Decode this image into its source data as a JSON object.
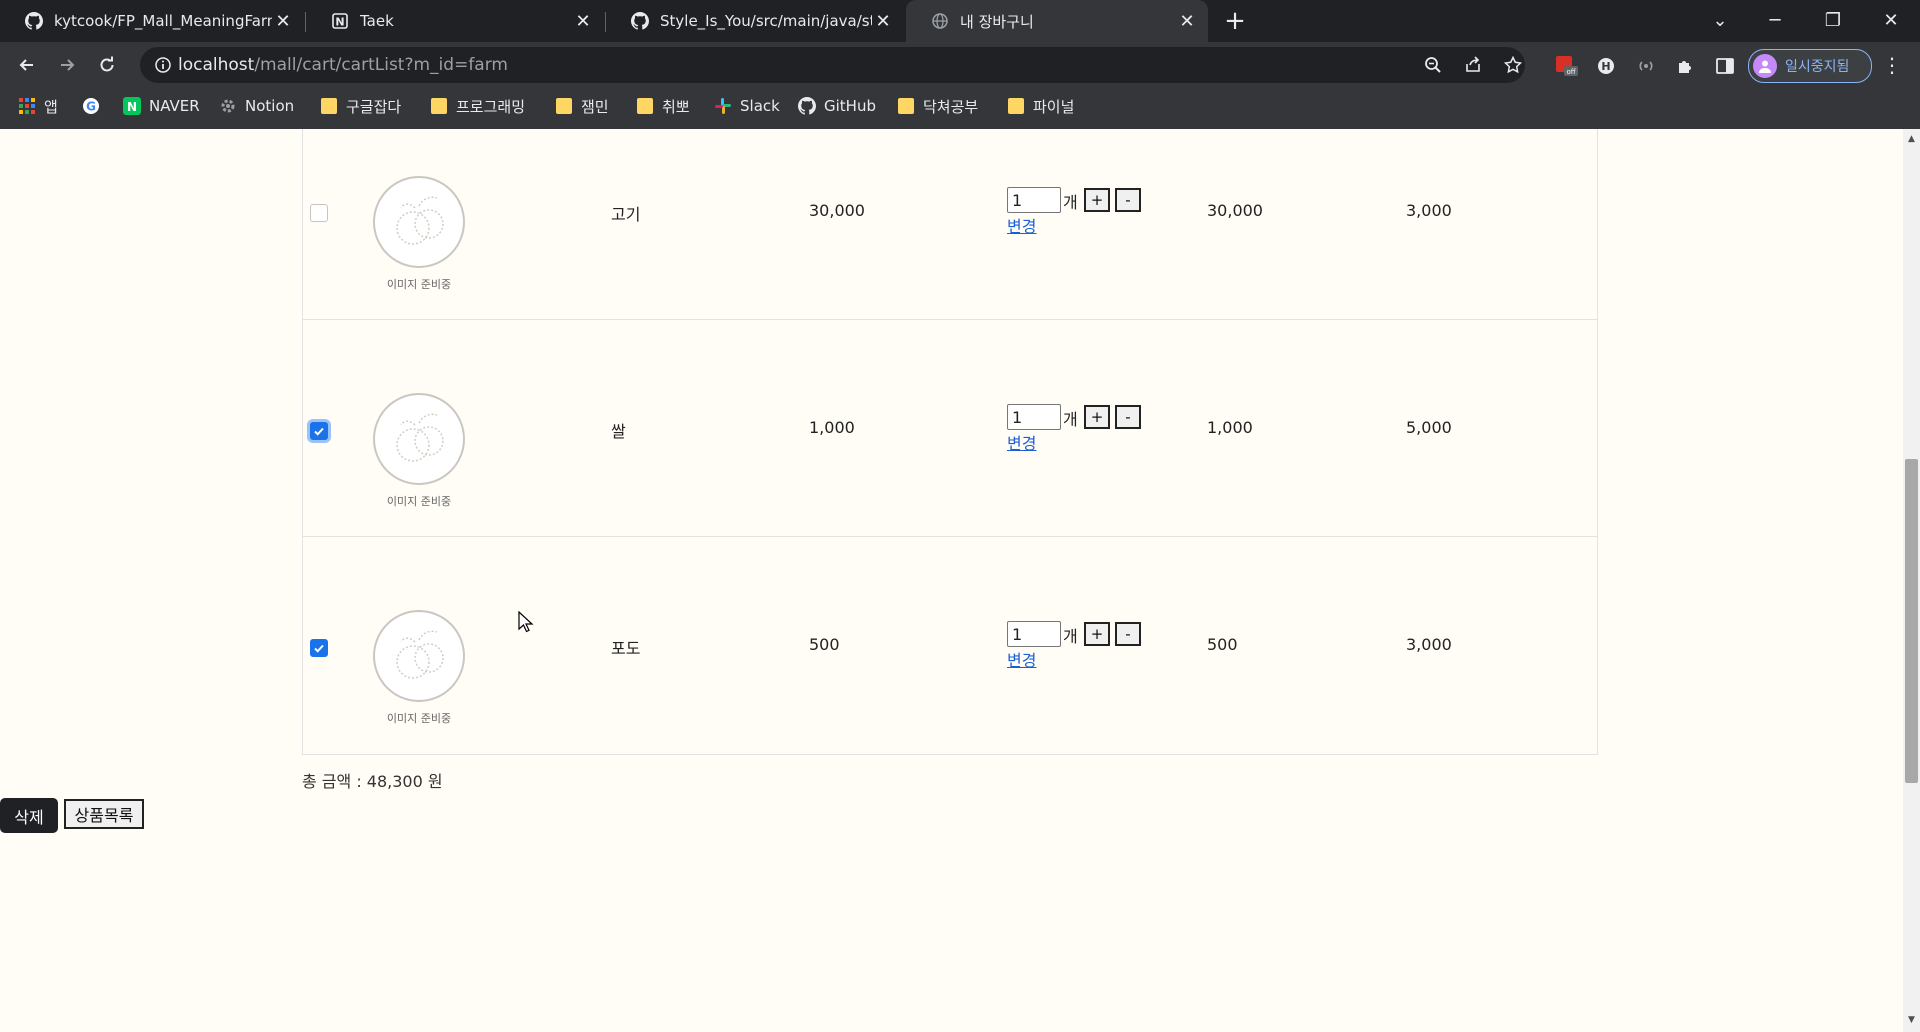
{
  "browser": {
    "tabs": [
      {
        "title": "kytcook/FP_Mall_MeaningFarm",
        "icon": "github-icon",
        "active": false
      },
      {
        "title": "Taek",
        "icon": "notion-icon",
        "active": false
      },
      {
        "title": "Style_Is_You/src/main/java/stu/sl",
        "icon": "github-icon",
        "active": false
      },
      {
        "title": "내 장바구니",
        "icon": "globe-icon",
        "active": true
      }
    ],
    "new_tab": "+",
    "address": {
      "host": "localhost",
      "path": "/mall/cart/cartList?m_id=farm"
    },
    "profile_label": "일시중지됨",
    "bookmarks": [
      {
        "label": "앱",
        "icon": "apps-grid-icon"
      },
      {
        "label": "",
        "icon": "google-icon"
      },
      {
        "label": "NAVER",
        "icon": "naver-icon"
      },
      {
        "label": "Notion",
        "icon": "gear-icon"
      },
      {
        "label": "구글잡다",
        "icon": "folder-icon"
      },
      {
        "label": "프로그래밍",
        "icon": "folder-icon"
      },
      {
        "label": "잼민",
        "icon": "folder-icon"
      },
      {
        "label": "취뽀",
        "icon": "folder-icon"
      },
      {
        "label": "Slack",
        "icon": "slack-icon"
      },
      {
        "label": "GitHub",
        "icon": "github-icon"
      },
      {
        "label": "닥쳐공부",
        "icon": "folder-icon"
      },
      {
        "label": "파이널",
        "icon": "folder-icon"
      }
    ]
  },
  "cart": {
    "image_placeholder": "이미지 준비중",
    "qty_unit": "개",
    "plus_label": "+",
    "minus_label": "-",
    "change_label": "변경",
    "items": [
      {
        "name": "고기",
        "price": "30,000",
        "qty": "1",
        "subtotal": "30,000",
        "shipping": "3,000",
        "checked": false
      },
      {
        "name": "쌀",
        "price": "1,000",
        "qty": "1",
        "subtotal": "1,000",
        "shipping": "5,000",
        "checked": true
      },
      {
        "name": "포도",
        "price": "500",
        "qty": "1",
        "subtotal": "500",
        "shipping": "3,000",
        "checked": true
      }
    ],
    "total_text": "총 금액 : 48,300 원",
    "delete_label": "삭제",
    "product_list_label": "상품목록"
  },
  "colors": {
    "checkbox_checked": "#1a73e8",
    "link": "#1a5fd6",
    "page_background": "#fffdf6",
    "chrome_dark": "#202124"
  }
}
